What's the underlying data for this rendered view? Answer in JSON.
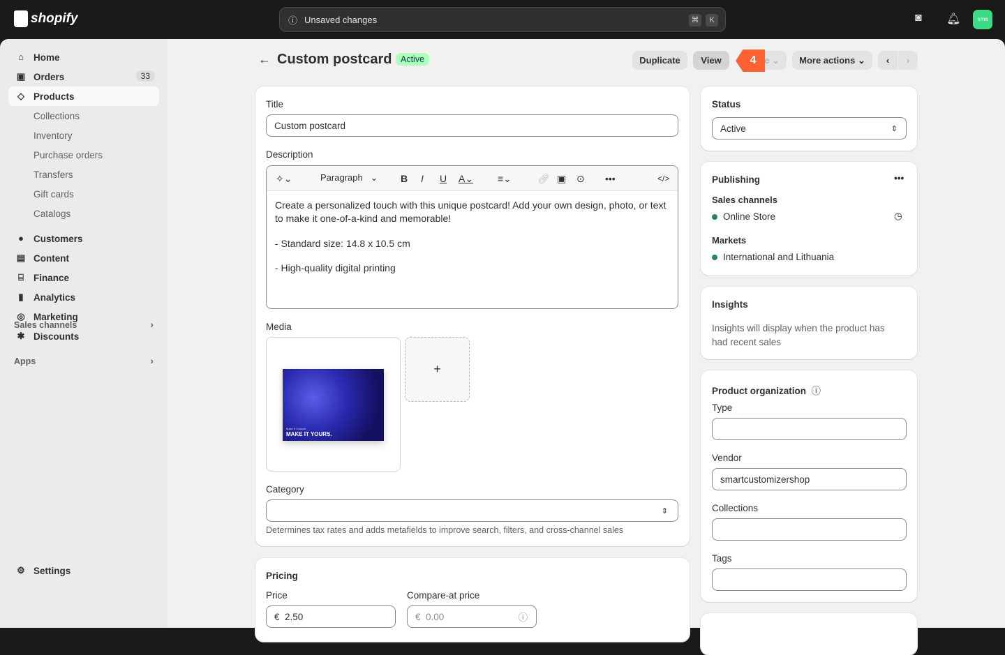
{
  "topbar": {
    "brand": "shopify",
    "search_text": "Unsaved changes",
    "kbd1": "⌘",
    "kbd2": "K",
    "avatar": "sma"
  },
  "sidebar": {
    "items": [
      {
        "label": "Home",
        "icon": "home-icon",
        "glyph": "⌂"
      },
      {
        "label": "Orders",
        "icon": "orders-icon",
        "glyph": "▣",
        "badge": "33"
      },
      {
        "label": "Products",
        "icon": "tag-icon",
        "glyph": "◇"
      },
      {
        "label": "Collections"
      },
      {
        "label": "Inventory"
      },
      {
        "label": "Purchase orders"
      },
      {
        "label": "Transfers"
      },
      {
        "label": "Gift cards"
      },
      {
        "label": "Catalogs"
      },
      {
        "label": "Customers",
        "icon": "person-icon",
        "glyph": "●"
      },
      {
        "label": "Content",
        "icon": "content-icon",
        "glyph": "▤"
      },
      {
        "label": "Finance",
        "icon": "bank-icon",
        "glyph": "⌸"
      },
      {
        "label": "Analytics",
        "icon": "chart-icon",
        "glyph": "▮"
      },
      {
        "label": "Marketing",
        "icon": "target-icon",
        "glyph": "◎"
      },
      {
        "label": "Discounts",
        "icon": "discount-icon",
        "glyph": "✱"
      }
    ],
    "sales_channels": "Sales channels",
    "apps": "Apps",
    "settings": "Settings"
  },
  "header": {
    "title": "Custom postcard",
    "status": "Active",
    "duplicate": "Duplicate",
    "view": "View",
    "hidden_button": "e",
    "step_badge": "4",
    "more_actions": "More actions"
  },
  "product": {
    "title_label": "Title",
    "title_value": "Custom postcard",
    "description_label": "Description",
    "toolbar": {
      "paragraph": "Paragraph"
    },
    "description": [
      "Create a personalized touch with this unique postcard! Add your own design, photo, or text to make it one-of-a-kind and memorable!",
      "- Standard size: 14.8 x 10.5 cm",
      "- High-quality digital printing"
    ],
    "media_label": "Media",
    "media_caption_small": "Make It Custom.",
    "media_caption": "MAKE IT YOURS.",
    "add_media": "+",
    "category_label": "Category",
    "category_help": "Determines tax rates and adds metafields to improve search, filters, and cross-channel sales"
  },
  "pricing": {
    "title": "Pricing",
    "price_label": "Price",
    "currency": "€",
    "price": "2.50",
    "compare_label": "Compare-at price",
    "compare_placeholder": "0.00"
  },
  "status_card": {
    "title": "Status",
    "value": "Active"
  },
  "publishing": {
    "title": "Publishing",
    "sales_channels": "Sales channels",
    "channel": "Online Store",
    "markets_label": "Markets",
    "markets": "International and Lithuania"
  },
  "insights": {
    "title": "Insights",
    "text": "Insights will display when the product has had recent sales"
  },
  "organization": {
    "title": "Product organization",
    "type": "Type",
    "vendor": "Vendor",
    "vendor_value": "smartcustomizershop",
    "collections": "Collections",
    "tags": "Tags"
  },
  "colors": {
    "accent_badge": "#ff6130",
    "active_badge": "#affebf",
    "dot": "#29845a"
  }
}
